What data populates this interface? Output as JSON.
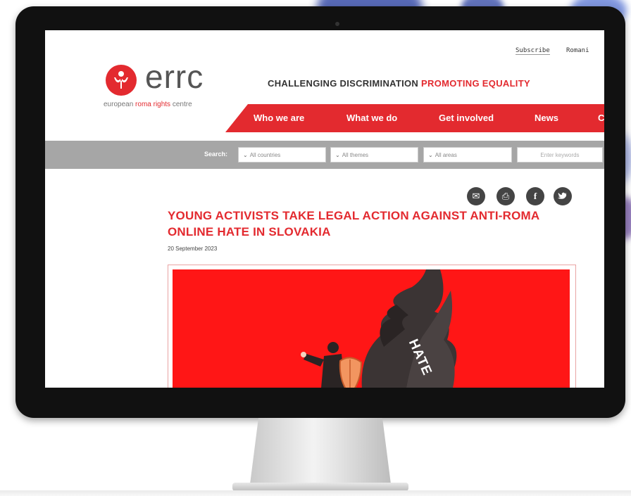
{
  "site": {
    "topbar": {
      "subscribe": "Subscribe",
      "language": "Romani"
    },
    "logo": {
      "wordmark": "errc",
      "sub_part1": "european ",
      "sub_part2": "roma rights",
      "sub_part3": " centre"
    },
    "tagline": {
      "part1": "CHALLENGING DISCRIMINATION ",
      "part2": "PROMOTING EQUALITY"
    },
    "nav": {
      "items": [
        "Who we are",
        "What we do",
        "Get involved",
        "News",
        "C"
      ]
    },
    "search": {
      "label": "Search:",
      "countries": "All countries",
      "themes": "All themes",
      "areas": "All areas",
      "keywords_placeholder": "Enter keywords"
    },
    "article": {
      "title": "YOUNG ACTIVISTS TAKE LEGAL ACTION AGAINST ANTI-ROMA ONLINE HATE IN SLOVAKIA",
      "date": "20 September 2023",
      "hero_word": "HATE"
    },
    "share_icons": [
      "email-icon",
      "print-icon",
      "facebook-icon",
      "twitter-icon"
    ]
  },
  "colors": {
    "brand_red": "#e32a2f",
    "hero_red": "#ff1616",
    "search_gray": "#a6a6a6"
  }
}
